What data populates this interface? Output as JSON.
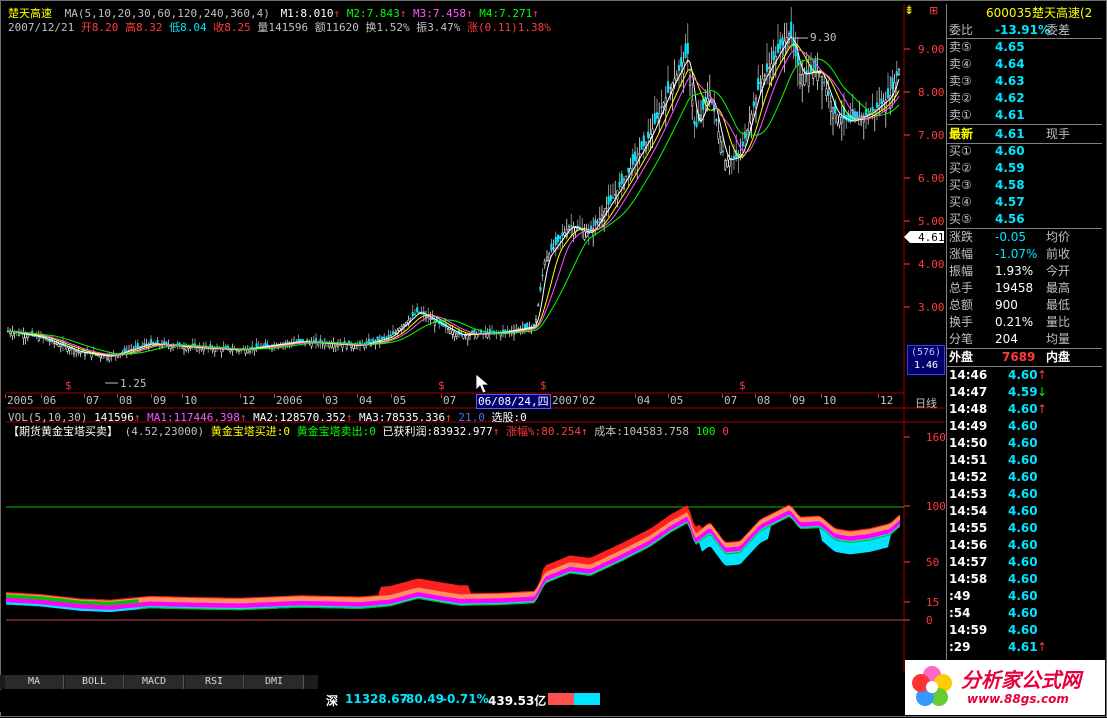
{
  "header": {
    "stock_name": "楚天高速",
    "ma_line": "MA(5,10,20,30,60,120,240,360,4)",
    "m1": "M1:8.010",
    "m2": "M2:7.843",
    "m3": "M3:7.458",
    "m4": "M4:7.271",
    "date": "2007/12/21",
    "open": "开8.20",
    "high": "高8.32",
    "low": "低8.04",
    "close": "收8.25",
    "vol": "量141596",
    "amount": "额11620",
    "turnover": "换1.52%",
    "amplitude": "振3.47%",
    "change": "涨(0.11)1.38%"
  },
  "price_axis": [
    "9.00",
    "8.00",
    "7.00",
    "6.00",
    "5.00",
    "4.00",
    "3.00"
  ],
  "price_marker": "4.61",
  "peak_label": "9.30",
  "low_label": "1.25",
  "counter_box": {
    "count": "(576)",
    "value": "1.46"
  },
  "date_axis": [
    {
      "label": "2005"
    },
    {
      "label": "06"
    },
    {
      "label": "07"
    },
    {
      "label": "08"
    },
    {
      "label": "09"
    },
    {
      "label": "10"
    },
    {
      "label": "12"
    },
    {
      "label": "2006"
    },
    {
      "label": "03"
    },
    {
      "label": "04"
    },
    {
      "label": "05"
    },
    {
      "label": "07"
    },
    {
      "label": "06/08/24,四"
    },
    {
      "label": "2007"
    },
    {
      "label": "02"
    },
    {
      "label": "04"
    },
    {
      "label": "05"
    },
    {
      "label": "07"
    },
    {
      "label": "08"
    },
    {
      "label": "09"
    },
    {
      "label": "10"
    },
    {
      "label": "12"
    }
  ],
  "period_label": "日线",
  "vol_line": {
    "label": "VOL(5,10,30)",
    "vol": "141596",
    "ma1": "MA1:117446.398",
    "ma2": "MA2:128570.352",
    "ma3": "MA3:78535.336",
    "extra": "21.0",
    "pick": "选股:0"
  },
  "indicator_line": {
    "name": "【期货黄金宝塔买卖】",
    "params": "(4.52,23000)",
    "buy": "黄金宝塔买进:0",
    "sell": "黄金宝塔卖出:0",
    "profit": "已获利润:83932.977",
    "rise": "涨幅%:80.254",
    "cost": "成本:104583.758",
    "hundred": "100",
    "zero": "0"
  },
  "indicator_axis": [
    "160",
    "100",
    "50",
    "15",
    "0"
  ],
  "quote": {
    "code": "600035",
    "name": "楚天高速(2",
    "ratio_label": "委比",
    "ratio_value": "-13.91%",
    "diff_label": "委差",
    "sells": [
      {
        "label": "卖⑤",
        "price": "4.65"
      },
      {
        "label": "卖④",
        "price": "4.64"
      },
      {
        "label": "卖③",
        "price": "4.63"
      },
      {
        "label": "卖②",
        "price": "4.62"
      },
      {
        "label": "卖①",
        "price": "4.61"
      }
    ],
    "latest_label": "最新",
    "latest_price": "4.61",
    "latest_hand": "现手",
    "buys": [
      {
        "label": "买①",
        "price": "4.60"
      },
      {
        "label": "买②",
        "price": "4.59"
      },
      {
        "label": "买③",
        "price": "4.58"
      },
      {
        "label": "买④",
        "price": "4.57"
      },
      {
        "label": "买⑤",
        "price": "4.56"
      }
    ],
    "stats": [
      {
        "label": "涨跌",
        "value": "-0.05",
        "label2": "均价"
      },
      {
        "label": "涨幅",
        "value": "-1.07%",
        "label2": "前收"
      },
      {
        "label": "振幅",
        "value": "1.93%",
        "label2": "今开"
      },
      {
        "label": "总手",
        "value": "19458",
        "label2": "最高"
      },
      {
        "label": "总额",
        "value": "900",
        "label2": "最低"
      },
      {
        "label": "换手",
        "value": "0.21%",
        "label2": "量比"
      },
      {
        "label": "分笔",
        "value": "204",
        "label2": "均量"
      }
    ],
    "outer_label": "外盘",
    "outer_value": "7689",
    "inner_label": "内盘",
    "ticks": [
      {
        "time": "14:46",
        "price": "4.60",
        "arrow": "↑"
      },
      {
        "time": "14:47",
        "price": "4.59",
        "arrow": "↓"
      },
      {
        "time": "14:48",
        "price": "4.60",
        "arrow": "↑"
      },
      {
        "time": "14:49",
        "price": "4.60",
        "arrow": ""
      },
      {
        "time": "14:50",
        "price": "4.60",
        "arrow": ""
      },
      {
        "time": "14:51",
        "price": "4.60",
        "arrow": ""
      },
      {
        "time": "14:52",
        "price": "4.60",
        "arrow": ""
      },
      {
        "time": "14:53",
        "price": "4.60",
        "arrow": ""
      },
      {
        "time": "14:54",
        "price": "4.60",
        "arrow": ""
      },
      {
        "time": "14:55",
        "price": "4.60",
        "arrow": ""
      },
      {
        "time": "14:56",
        "price": "4.60",
        "arrow": ""
      },
      {
        "time": "14:57",
        "price": "4.60",
        "arrow": ""
      },
      {
        "time": "14:58",
        "price": "4.60",
        "arrow": ""
      },
      {
        "time": ":49",
        "price": "4.60",
        "arrow": ""
      },
      {
        "time": ":54",
        "price": "4.60",
        "arrow": ""
      },
      {
        "time": "14:59",
        "price": "4.60",
        "arrow": ""
      },
      {
        "time": ":29",
        "price": "4.61",
        "arrow": "↑"
      }
    ]
  },
  "tabs": [
    "MA",
    "BOLL",
    "MACD",
    "RSI",
    "DMI"
  ],
  "status": {
    "index_name": "深",
    "index_value": "11328.67",
    "index_change": "-80.49",
    "index_pct": "-0.71%",
    "index_amount": "439.53亿"
  },
  "logo": {
    "text": "分析家公式网",
    "url_text": "www.88gs.com"
  },
  "colors": {
    "up": "#ff3b3b",
    "down": "#00e5ff",
    "text_yellow": "#ffff00",
    "axis_red": "#ff3b3b",
    "ma_green": "#00ff00",
    "ma_magenta": "#ff55ff"
  }
}
